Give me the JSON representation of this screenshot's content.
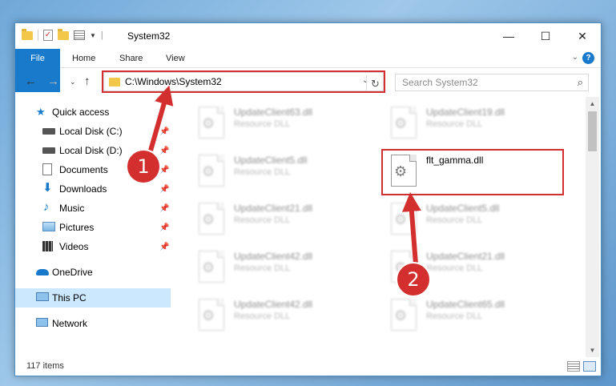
{
  "window": {
    "title": "System32",
    "controls": {
      "minimize": "—",
      "maximize": "☐",
      "close": "✕"
    }
  },
  "ribbon": {
    "tabs": [
      "File",
      "Home",
      "Share",
      "View"
    ],
    "help": "?"
  },
  "address": {
    "path": "C:\\Windows\\System32",
    "search_placeholder": "Search System32"
  },
  "sidebar": {
    "items": [
      {
        "label": "Quick access",
        "icon": "star-icon",
        "pinned": false
      },
      {
        "label": "Local Disk (C:)",
        "icon": "drive-icon",
        "pinned": true
      },
      {
        "label": "Local Disk (D:)",
        "icon": "drive-icon",
        "pinned": true
      },
      {
        "label": "Documents",
        "icon": "documents-icon",
        "pinned": true
      },
      {
        "label": "Downloads",
        "icon": "download-icon",
        "pinned": true
      },
      {
        "label": "Music",
        "icon": "music-icon",
        "pinned": true
      },
      {
        "label": "Pictures",
        "icon": "pictures-icon",
        "pinned": true
      },
      {
        "label": "Videos",
        "icon": "videos-icon",
        "pinned": true
      },
      {
        "label": "OneDrive",
        "icon": "cloud-icon",
        "pinned": false
      },
      {
        "label": "This PC",
        "icon": "computer-icon",
        "pinned": false,
        "selected": true
      },
      {
        "label": "Network",
        "icon": "network-icon",
        "pinned": false
      }
    ]
  },
  "files": [
    {
      "name": "UpdateClient63.dll",
      "type": "Resource DLL",
      "blurred": true
    },
    {
      "name": "UpdateClient19.dll",
      "type": "Resource DLL",
      "blurred": true
    },
    {
      "name": "UpdateClient5.dll",
      "type": "Resource DLL",
      "blurred": true
    },
    {
      "name": "flt_gamma.dll",
      "type": "",
      "blurred": false,
      "highlighted": true
    },
    {
      "name": "UpdateClient21.dll",
      "type": "Resource DLL",
      "blurred": true
    },
    {
      "name": "UpdateClient5.dll",
      "type": "Resource DLL",
      "blurred": true
    },
    {
      "name": "UpdateClient42.dll",
      "type": "Resource DLL",
      "blurred": true
    },
    {
      "name": "UpdateClient21.dll",
      "type": "Resource DLL",
      "blurred": true
    },
    {
      "name": "UpdateClient42.dll",
      "type": "Resource DLL",
      "blurred": true
    },
    {
      "name": "UpdateClient65.dll",
      "type": "Resource DLL",
      "blurred": true
    }
  ],
  "status": {
    "item_count": "117 items"
  },
  "callouts": {
    "step1": "1",
    "step2": "2"
  },
  "colors": {
    "accent": "#1979ca",
    "highlight": "#d32f2f",
    "selected": "#cce8ff"
  }
}
